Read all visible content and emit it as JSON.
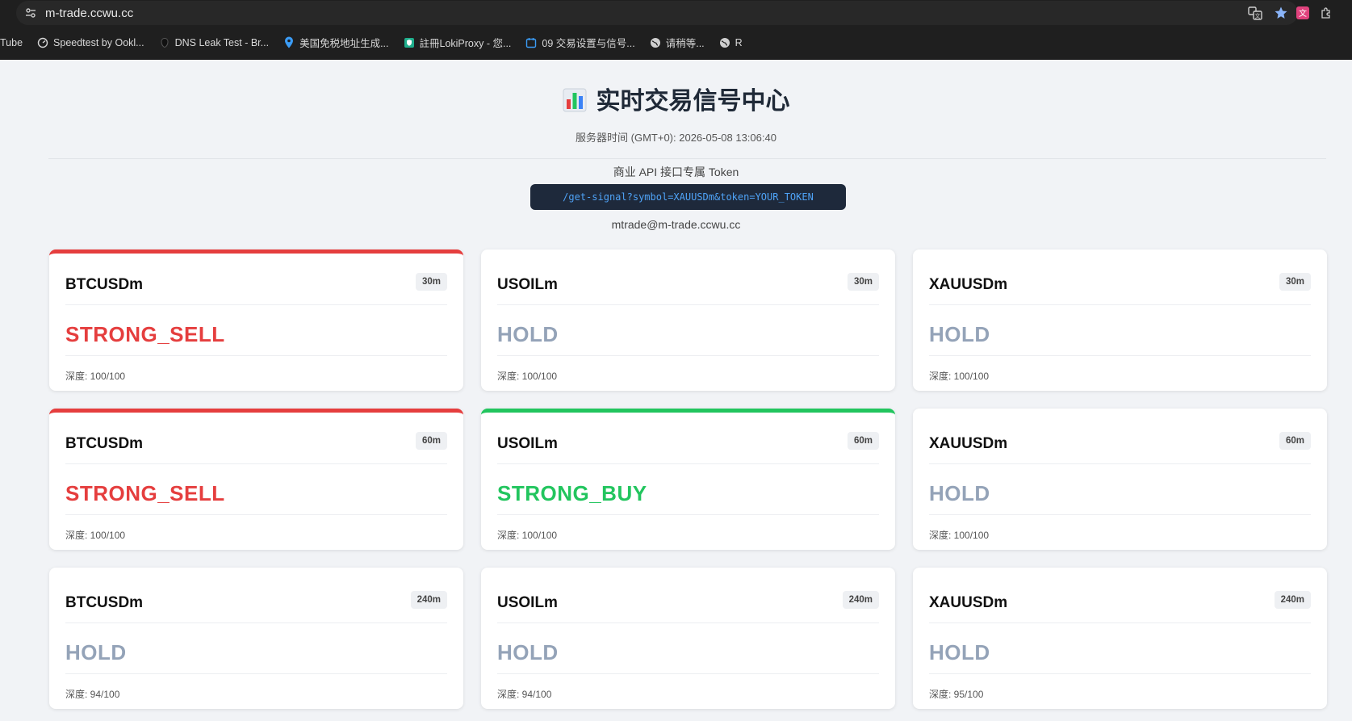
{
  "browser": {
    "url": "m-trade.ccwu.cc",
    "bookmarks": [
      {
        "label": "Tube",
        "icon": "youtube-icon"
      },
      {
        "label": "Speedtest by Ookl...",
        "icon": "speedtest-icon"
      },
      {
        "label": "DNS Leak Test - Br...",
        "icon": "dns-icon"
      },
      {
        "label": "美国免税地址生成...",
        "icon": "location-pin-icon"
      },
      {
        "label": "註冊LokiProxy - 您...",
        "icon": "shield-icon"
      },
      {
        "label": "09 交易设置与信号...",
        "icon": "calendar-icon"
      },
      {
        "label": "请稍等...",
        "icon": "globe-icon"
      },
      {
        "label": "R",
        "icon": "globe-icon"
      }
    ]
  },
  "page": {
    "title": "实时交易信号中心",
    "server_time": "服务器时间 (GMT+0): 2026-05-08 13:06:40",
    "api_label": "商业 API 接口专属 Token",
    "api_code": "/get-signal?symbol=XAUUSDm&token=YOUR_TOKEN",
    "email": "mtrade@m-trade.ccwu.cc"
  },
  "colors": {
    "sell": "#e53e3e",
    "buy": "#22c55e",
    "hold": "#94a3b8",
    "code_bg": "#1e293b"
  },
  "cards": [
    {
      "symbol": "BTCUSDm",
      "timeframe": "30m",
      "signal": "STRONG_SELL",
      "depth": "深度: 100/100"
    },
    {
      "symbol": "USOILm",
      "timeframe": "30m",
      "signal": "HOLD",
      "depth": "深度: 100/100"
    },
    {
      "symbol": "XAUUSDm",
      "timeframe": "30m",
      "signal": "HOLD",
      "depth": "深度: 100/100"
    },
    {
      "symbol": "BTCUSDm",
      "timeframe": "60m",
      "signal": "STRONG_SELL",
      "depth": "深度: 100/100"
    },
    {
      "symbol": "USOILm",
      "timeframe": "60m",
      "signal": "STRONG_BUY",
      "depth": "深度: 100/100"
    },
    {
      "symbol": "XAUUSDm",
      "timeframe": "60m",
      "signal": "HOLD",
      "depth": "深度: 100/100"
    },
    {
      "symbol": "BTCUSDm",
      "timeframe": "240m",
      "signal": "HOLD",
      "depth": "深度: 94/100"
    },
    {
      "symbol": "USOILm",
      "timeframe": "240m",
      "signal": "HOLD",
      "depth": "深度: 94/100"
    },
    {
      "symbol": "XAUUSDm",
      "timeframe": "240m",
      "signal": "HOLD",
      "depth": "深度: 95/100"
    }
  ]
}
